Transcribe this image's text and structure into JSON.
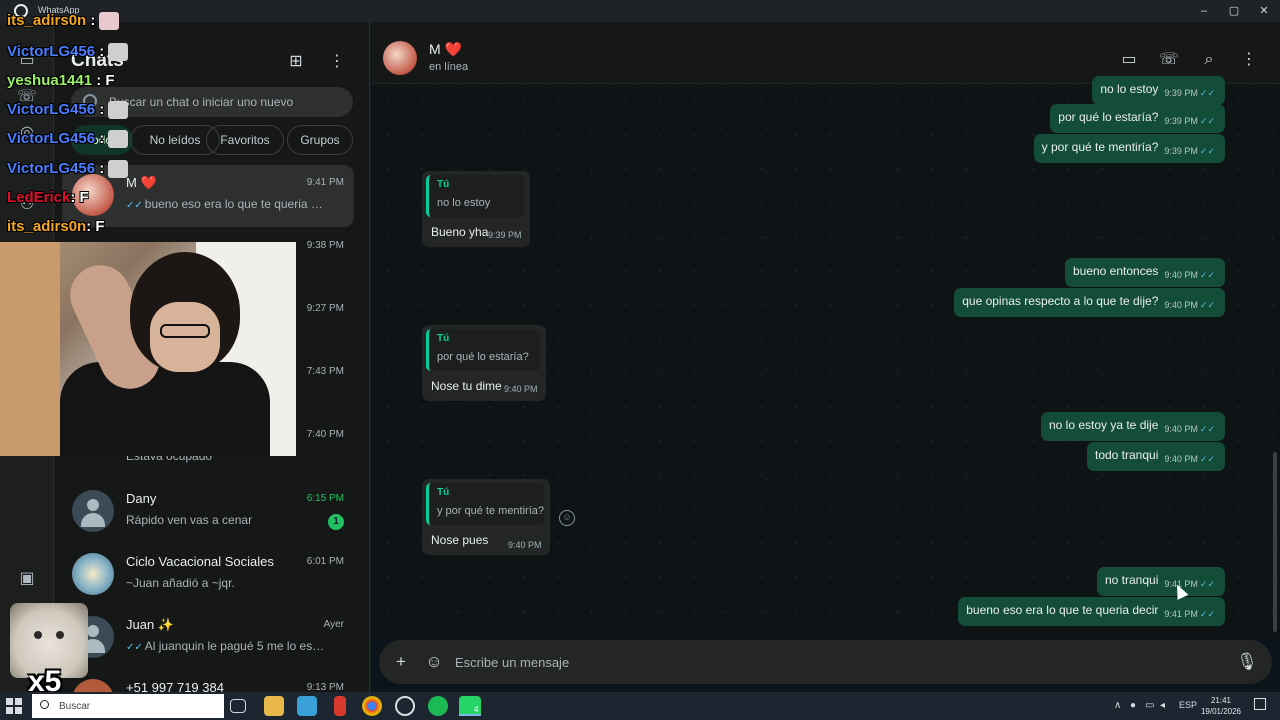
{
  "window": {
    "title": "WhatsApp",
    "minimize": "–",
    "maximize": "▢",
    "close": "✕"
  },
  "rail": {
    "icons": [
      "chats-icon",
      "calls-icon",
      "status-icon",
      "channels-icon",
      "communities-icon",
      "media-icon"
    ]
  },
  "list": {
    "title": "Chats",
    "new_chat_icon": "new-chat-icon",
    "menu_icon": "menu-icon",
    "search_placeholder": "Buscar un chat o iniciar uno nuevo",
    "filters": [
      "Todos",
      "No leídos",
      "Favoritos",
      "Grupos"
    ],
    "chats": [
      {
        "name": "M ❤️",
        "time": "9:41 PM",
        "preview": "bueno eso era lo que te queria decir",
        "ticks": "✓✓"
      },
      {
        "name": "",
        "time": "9:38 PM",
        "preview": ""
      },
      {
        "name": "",
        "time": "9:27 PM",
        "preview": ""
      },
      {
        "name": "",
        "time": "7:43 PM",
        "preview": ""
      },
      {
        "name": "",
        "time": "7:40 PM",
        "preview": "Estava ocupado"
      },
      {
        "name": "Dany",
        "time": "6:15 PM",
        "preview": "Rápido ven vas a cenar",
        "badge": "1"
      },
      {
        "name": "Ciclo Vacacional Sociales",
        "time": "6:01 PM",
        "preview": "~Juan añadió a ~jqr."
      },
      {
        "name": "Juan ✨",
        "time": "Ayer",
        "preview": "Al juanquin le pagué 5 me lo está h...",
        "ticks": "✓✓"
      },
      {
        "name": "+51 997 719 384",
        "time": "9:13 PM",
        "preview": ""
      }
    ]
  },
  "overlay": {
    "chat_lines": [
      {
        "user": "its_adirs0n",
        "text": ":",
        "color": "#f5a623"
      },
      {
        "user": "VictorLG456",
        "text": ":",
        "color": "#4a7dff"
      },
      {
        "user": "yeshua1441",
        "text": ": F",
        "color": "#9cf06a"
      },
      {
        "user": "VictorLG456",
        "text": ":",
        "color": "#4a7dff"
      },
      {
        "user": "VictorLG456",
        "text": ":",
        "color": "#4a7dff"
      },
      {
        "user": "VictorLG456",
        "text": ":",
        "color": "#4a7dff"
      },
      {
        "user": "LedErick",
        "text": ": F",
        "color": "#e0102a"
      },
      {
        "user": "its_adirs0n",
        "text": ": F",
        "color": "#f5a623"
      }
    ],
    "emote_count": "x5"
  },
  "conversation": {
    "contact_name": "M ❤️",
    "contact_status": "en línea",
    "header_icons": [
      "video-call-icon",
      "voice-call-icon",
      "search-icon",
      "menu-icon"
    ],
    "messages_out": [
      {
        "text": "no lo estoy",
        "time": "9:39 PM"
      },
      {
        "text": "por qué lo estaría?",
        "time": "9:39 PM"
      },
      {
        "text": "y por qué te mentiría?",
        "time": "9:39 PM"
      },
      {
        "text": "bueno entonces",
        "time": "9:40 PM"
      },
      {
        "text": "que opinas respecto a lo que te dije?",
        "time": "9:40 PM"
      },
      {
        "text": "no lo estoy ya te dije",
        "time": "9:40 PM"
      },
      {
        "text": "todo tranqui",
        "time": "9:40 PM"
      },
      {
        "text": "no tranqui",
        "time": "9:41 PM"
      },
      {
        "text": "bueno eso era lo que te queria decir",
        "time": "9:41 PM"
      }
    ],
    "replies_in": [
      {
        "quote_author": "Tú",
        "quote_text": "no lo estoy",
        "text": "Bueno yha",
        "time": "9:39 PM"
      },
      {
        "quote_author": "Tú",
        "quote_text": "por qué lo estaría?",
        "text": "Nose tu dime",
        "time": "9:40 PM"
      },
      {
        "quote_author": "Tú",
        "quote_text": "y por qué te mentiría?",
        "text": "Nose pues",
        "time": "9:40 PM"
      }
    ],
    "ticks": "✓✓",
    "composer_placeholder": "Escribe un mensaje"
  },
  "taskbar": {
    "search_placeholder": "Buscar",
    "whatsapp_badge": "4",
    "language": "ESP",
    "time": "21:41",
    "date": "19/01/2026"
  }
}
